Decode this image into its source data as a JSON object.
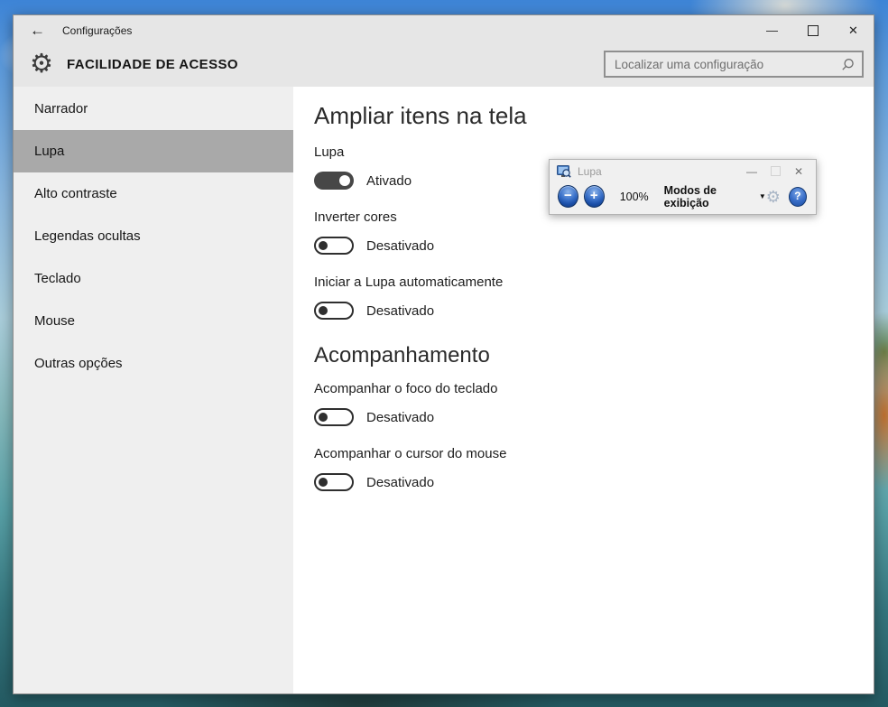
{
  "settings_window": {
    "titlebar": {
      "title": "Configurações"
    },
    "header": {
      "title": "FACILIDADE DE ACESSO",
      "search": {
        "placeholder": "Localizar uma configuração"
      }
    },
    "sidebar": {
      "items": [
        {
          "label": "Narrador",
          "selected": false
        },
        {
          "label": "Lupa",
          "selected": true
        },
        {
          "label": "Alto contraste",
          "selected": false
        },
        {
          "label": "Legendas ocultas",
          "selected": false
        },
        {
          "label": "Teclado",
          "selected": false
        },
        {
          "label": "Mouse",
          "selected": false
        },
        {
          "label": "Outras opções",
          "selected": false
        }
      ]
    },
    "content": {
      "sections": [
        {
          "title": "Ampliar itens na tela",
          "settings": [
            {
              "label": "Lupa",
              "state": "Ativado",
              "enabled": true
            },
            {
              "label": "Inverter cores",
              "state": "Desativado",
              "enabled": false
            },
            {
              "label": "Iniciar a Lupa automaticamente",
              "state": "Desativado",
              "enabled": false
            }
          ]
        },
        {
          "title": "Acompanhamento",
          "settings": [
            {
              "label": "Acompanhar o foco do teclado",
              "state": "Desativado",
              "enabled": false
            },
            {
              "label": "Acompanhar o cursor do mouse",
              "state": "Desativado",
              "enabled": false
            }
          ]
        }
      ]
    }
  },
  "magnifier_toolbar": {
    "title": "Lupa",
    "zoom_level": "100%",
    "views_button": "Modos de exibição"
  },
  "icons": {
    "back": "←",
    "minimize": "—",
    "close": "✕",
    "gear": "⚙",
    "zoom_out": "−",
    "zoom_in": "+",
    "dropdown": "▼",
    "help": "?"
  },
  "colors": {
    "header_bg": "#e6e6e6",
    "sidebar_bg": "#efefef",
    "selected_item_bg": "#a9a9a9",
    "toggle_on": "#474747",
    "magnifier_button_blue": "#1b4fa8"
  }
}
